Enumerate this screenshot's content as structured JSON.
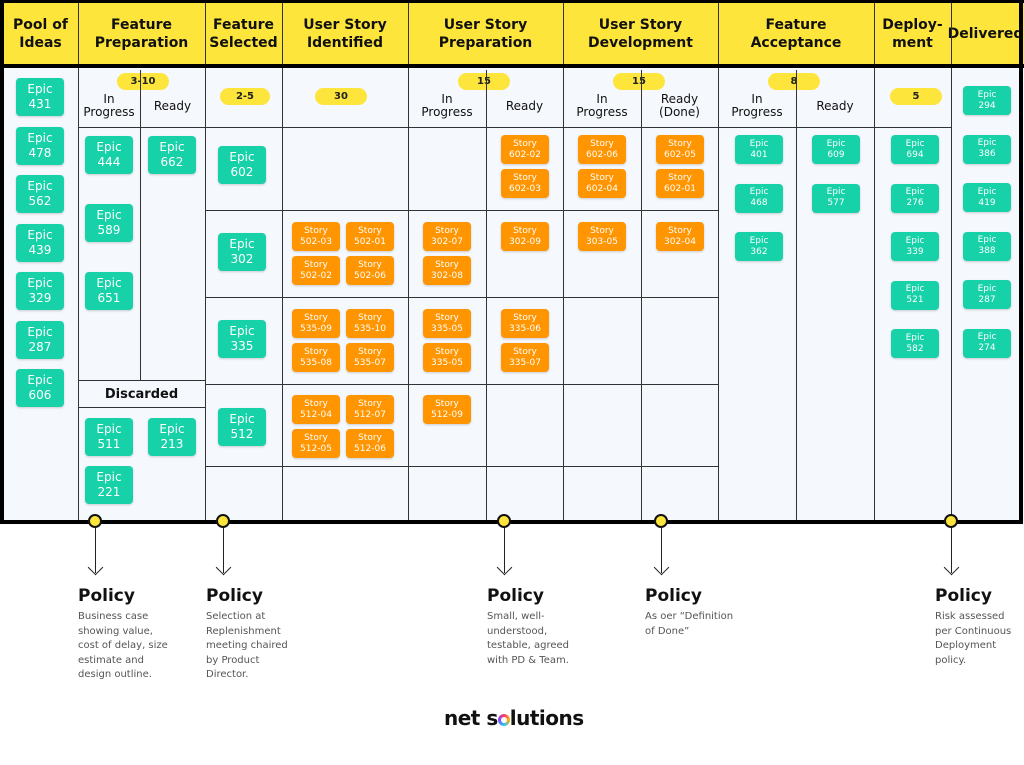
{
  "board": {
    "columns": [
      {
        "id": "pool",
        "label": "Pool of\nIdeas"
      },
      {
        "id": "feature-prep",
        "label": "Feature\nPreparation",
        "wip": "3-10",
        "sub": [
          "In\nProgress",
          "Ready"
        ]
      },
      {
        "id": "feature-selected",
        "label": "Feature\nSelected",
        "wip": "2-5"
      },
      {
        "id": "story-identified",
        "label": "User Story\nIdentified",
        "wip": "30"
      },
      {
        "id": "story-prep",
        "label": "User Story\nPreparation",
        "wip": "15",
        "sub": [
          "In\nProgress",
          "Ready"
        ]
      },
      {
        "id": "story-dev",
        "label": "User Story\nDevelopment",
        "wip": "15",
        "sub": [
          "In\nProgress",
          "Ready\n(Done)"
        ]
      },
      {
        "id": "feature-accept",
        "label": "Feature\nAcceptance",
        "wip": "8",
        "sub": [
          "In\nProgress",
          "Ready"
        ]
      },
      {
        "id": "deployment",
        "label": "Deploy-\nment",
        "wip": "5"
      },
      {
        "id": "delivered",
        "label": "Delivered"
      }
    ],
    "discarded_label": "Discarded",
    "colors": {
      "header": "#fde53b",
      "epic": "#17d1a8",
      "story": "#ff9500",
      "background": "#f5f8fc"
    },
    "pool": [
      "Epic\n431",
      "Epic\n478",
      "Epic\n562",
      "Epic\n439",
      "Epic\n329",
      "Epic\n287",
      "Epic\n606"
    ],
    "feature_prep_in_progress": [
      "Epic\n444",
      "Epic\n589",
      "Epic\n651"
    ],
    "feature_prep_ready": [
      "Epic\n662"
    ],
    "discarded": [
      "Epic\n511",
      "Epic\n213",
      "Epic\n221"
    ],
    "lanes": [
      {
        "epic": "Epic\n602",
        "identified": [],
        "prep_in_progress": [],
        "prep_ready": [
          "Story\n602-02",
          "Story\n602-03"
        ],
        "dev_in_progress": [
          "Story\n602-06",
          "Story\n602-04"
        ],
        "dev_done": [
          "Story\n602-05",
          "Story\n602-01"
        ]
      },
      {
        "epic": "Epic\n302",
        "identified": [
          "Story\n502-03",
          "Story\n502-01",
          "Story\n502-02",
          "Story\n502-06"
        ],
        "prep_in_progress": [
          "Story\n302-07",
          "Story\n302-08"
        ],
        "prep_ready": [
          "Story\n302-09"
        ],
        "dev_in_progress": [
          "Story\n303-05"
        ],
        "dev_done": [
          "Story\n302-04"
        ]
      },
      {
        "epic": "Epic\n335",
        "identified": [
          "Story\n535-09",
          "Story\n535-10",
          "Story\n535-08",
          "Story\n535-07"
        ],
        "prep_in_progress": [
          "Story\n335-05",
          "Story\n335-05"
        ],
        "prep_ready": [
          "Story\n335-06",
          "Story\n335-07"
        ],
        "dev_in_progress": [],
        "dev_done": []
      },
      {
        "epic": "Epic\n512",
        "identified": [
          "Story\n512-04",
          "Story\n512-07",
          "Story\n512-05",
          "Story\n512-06"
        ],
        "prep_in_progress": [
          "Story\n512-09"
        ],
        "prep_ready": [],
        "dev_in_progress": [],
        "dev_done": []
      }
    ],
    "accept_in_progress": [
      "Epic\n401",
      "Epic\n468",
      "Epic\n362"
    ],
    "accept_ready": [
      "Epic\n609",
      "Epic\n577"
    ],
    "deployment": [
      "Epic\n694",
      "Epic\n276",
      "Epic\n339",
      "Epic\n521",
      "Epic\n582"
    ],
    "delivered": [
      "Epic\n294",
      "Epic\n386",
      "Epic\n419",
      "Epic\n388",
      "Epic\n287",
      "Epic\n274"
    ]
  },
  "policies": [
    {
      "title": "Policy",
      "text": "Business case\nshowing value,\ncost of delay, size\nestimate and\ndesign outline."
    },
    {
      "title": "Policy",
      "text": "Selection at\nReplenishment\nmeeting chaired\nby Product\nDirector."
    },
    {
      "title": "Policy",
      "text": "Small, well-\nunderstood,\ntestable, agreed\nwith PD & Team."
    },
    {
      "title": "Policy",
      "text": "As oer “Definition\nof Done”"
    },
    {
      "title": "Policy",
      "text": "Risk assessed\nper Continuous\nDeployment\npolicy."
    }
  ],
  "brand": {
    "name_part1": "net s",
    "name_part2": "luti",
    "name_part3": "ns"
  }
}
